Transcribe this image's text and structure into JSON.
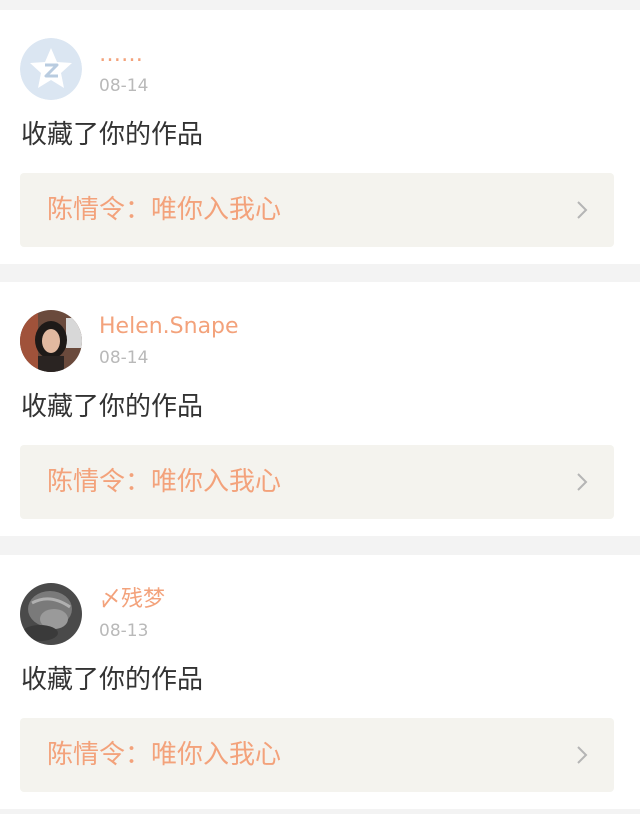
{
  "notifications": [
    {
      "username": "……",
      "date": "08-14",
      "action": "收藏了你的作品",
      "work_title": "陈情令：唯你入我心",
      "avatar": "qzone-star-avatar"
    },
    {
      "username": "Helen.Snape",
      "date": "08-14",
      "action": "收藏了你的作品",
      "work_title": "陈情令：唯你入我心",
      "avatar": "photo-avatar-person"
    },
    {
      "username": "〆残梦",
      "date": "08-13",
      "action": "收藏了你的作品",
      "work_title": "陈情令：唯你入我心",
      "avatar": "photo-avatar-grayscale"
    }
  ],
  "colors": {
    "accent": "#f3a27b",
    "link_bg": "#f4f3ee",
    "page_bg": "#f3f3f3",
    "date": "#b9b9b9",
    "text": "#333333"
  }
}
